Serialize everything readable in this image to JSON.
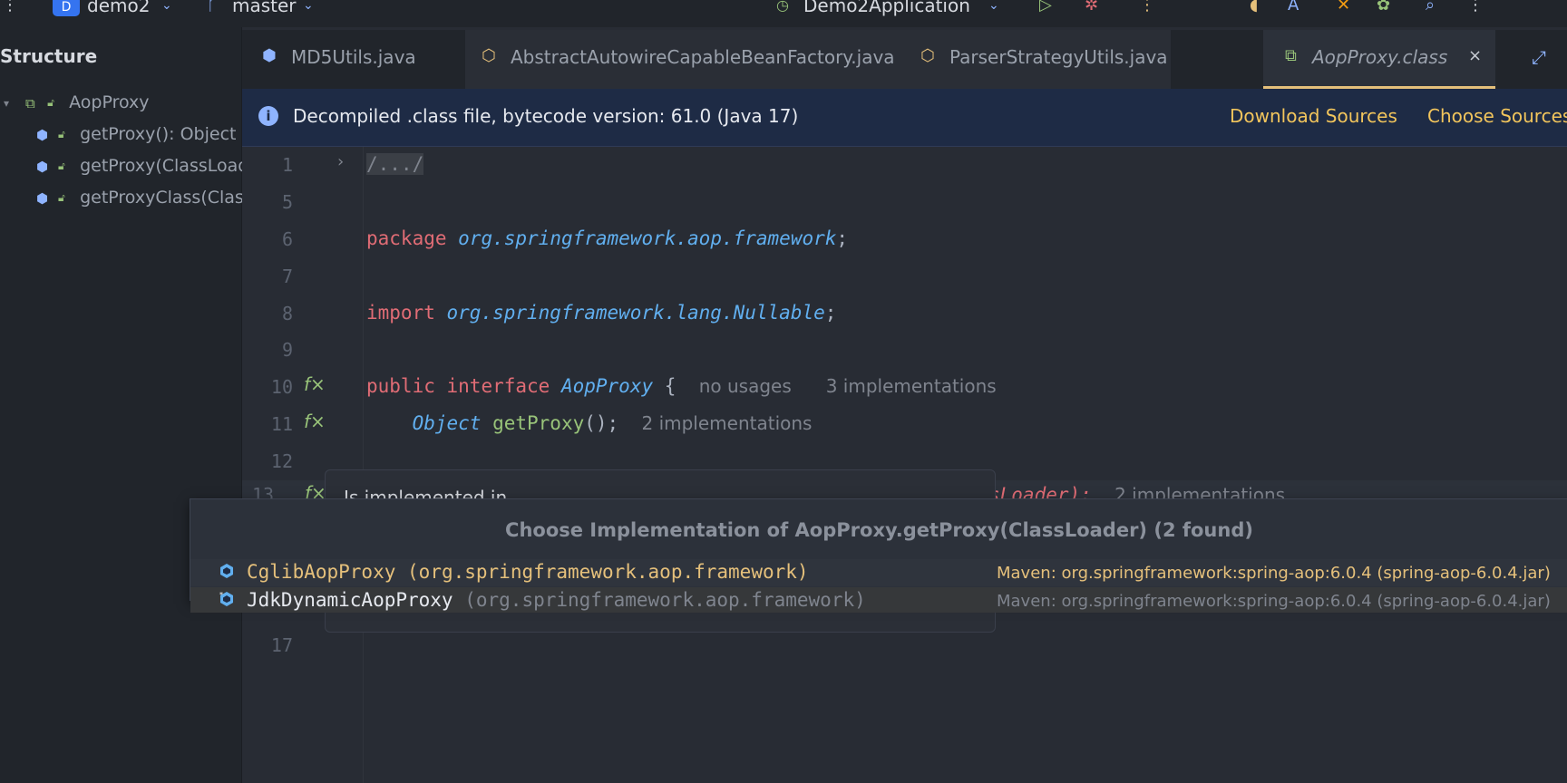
{
  "toolbar": {
    "project_badge": "D",
    "project": "demo2",
    "branch": "master",
    "run_config": "Demo2Application"
  },
  "sidebar": {
    "title": "Structure",
    "root": "AopProxy",
    "items": [
      {
        "label": "getProxy(): Object"
      },
      {
        "label": "getProxy(ClassLoader): Object"
      },
      {
        "label": "getProxyClass(ClassLoader): Class"
      }
    ]
  },
  "tabs": [
    {
      "label": "MD5Utils.java"
    },
    {
      "label": "AbstractAutowireCapableBeanFactory.java"
    },
    {
      "label": "ParserStrategyUtils.java"
    },
    {
      "label": "AopProxy.class",
      "close": "×"
    }
  ],
  "banner": {
    "message": "Decompiled .class file, bytecode version: 61.0 (Java 17)",
    "download": "Download Sources",
    "choose": "Choose Sources..."
  },
  "editor": {
    "line_numbers": [
      "1",
      "5",
      "6",
      "7",
      "8",
      "9",
      "10",
      "11",
      "12",
      "13",
      "17"
    ],
    "fold": "/.../",
    "package_kw": "package",
    "package_name": "org.springframework.aop.framework",
    "import_kw": "import",
    "import_name": "org.springframework.lang.Nullable",
    "public_kw": "public",
    "interface_kw": "interface",
    "iface_name": "AopProxy",
    "hint_usages": "no usages",
    "hint_impl3": "3 implementations",
    "object_type": "Object",
    "method_getproxy": "getProxy",
    "hint_impl2": "2 implementations",
    "line13_tail": "sLoader);",
    "line13_hint": "2 implementations"
  },
  "tooltip": {
    "text": "Is implemented in"
  },
  "chooser": {
    "title": "Choose Implementation of AopProxy.getProxy(ClassLoader) (2 found)",
    "items": [
      {
        "name": "CglibAopProxy",
        "package": "(org.springframework.aop.framework)",
        "location": "Maven: org.springframework:spring-aop:6.0.4 (spring-aop-6.0.4.jar)"
      },
      {
        "name": "JdkDynamicAopProxy",
        "package": "(org.springframework.aop.framework)",
        "location": "Maven: org.springframework:spring-aop:6.0.4 (spring-aop-6.0.4.jar)"
      }
    ]
  }
}
